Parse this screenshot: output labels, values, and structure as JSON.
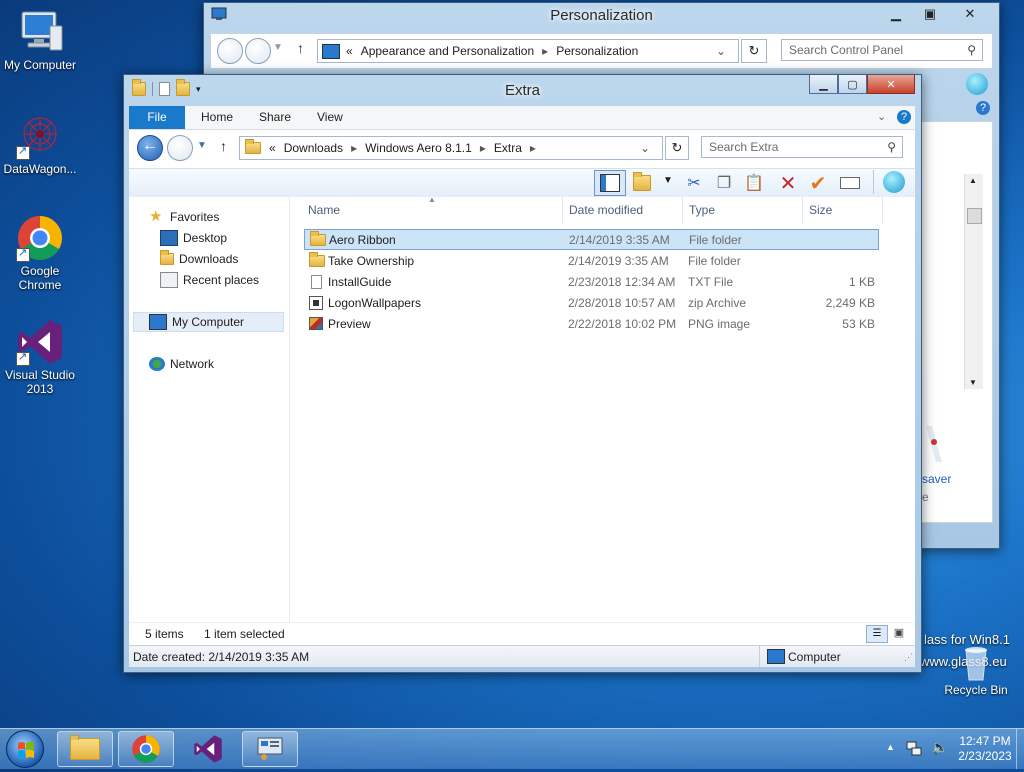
{
  "desktop": {
    "icons": [
      {
        "label": "My Computer"
      },
      {
        "label": "DataWagon..."
      },
      {
        "label": "Google\nChrome"
      },
      {
        "label": "Visual Studio\n2013"
      }
    ],
    "watermark_line1": "lass for Win8.1",
    "watermark_line2": "www.glass8.eu",
    "recycle_bin": "Recycle Bin"
  },
  "personalization": {
    "title": "Personalization",
    "breadcrumb_prefix": "«",
    "breadcrumb": [
      "Appearance and Personalization",
      "Personalization"
    ],
    "search_placeholder": "Search Control Panel",
    "partial_text1": "saver",
    "partial_text2": "e"
  },
  "explorer": {
    "title": "Extra",
    "ribbon_tabs": [
      "File",
      "Home",
      "Share",
      "View"
    ],
    "breadcrumb_prefix": "«",
    "breadcrumb": [
      "Downloads",
      "Windows Aero 8.1.1",
      "Extra"
    ],
    "search_placeholder": "Search Extra",
    "nav": {
      "favorites": "Favorites",
      "desktop": "Desktop",
      "downloads": "Downloads",
      "recent": "Recent places",
      "computer": "My Computer",
      "network": "Network"
    },
    "columns": [
      "Name",
      "Date modified",
      "Type",
      "Size"
    ],
    "files": [
      {
        "name": "Aero Ribbon",
        "date": "2/14/2019 3:35 AM",
        "type": "File folder",
        "size": "",
        "icon": "folder-icon"
      },
      {
        "name": "Take Ownership",
        "date": "2/14/2019 3:35 AM",
        "type": "File folder",
        "size": "",
        "icon": "folder-icon"
      },
      {
        "name": "InstallGuide",
        "date": "2/23/2018 12:34 AM",
        "type": "TXT File",
        "size": "1 KB",
        "icon": "text-file-icon"
      },
      {
        "name": "LogonWallpapers",
        "date": "2/28/2018 10:57 AM",
        "type": "zip Archive",
        "size": "2,249 KB",
        "icon": "zip-icon"
      },
      {
        "name": "Preview",
        "date": "2/22/2018 10:02 PM",
        "type": "PNG image",
        "size": "53 KB",
        "icon": "image-icon"
      }
    ],
    "selected_index": 0,
    "status_items": "5 items",
    "status_selected": "1 item selected",
    "details_text": "Date created: 2/14/2019 3:35 AM",
    "details_location": "Computer"
  },
  "taskbar": {
    "time": "12:47 PM",
    "date": "2/23/2023",
    "tray_arrow": "▲"
  },
  "colors": {
    "accent": "#1979ca",
    "selection": "#cce4f7",
    "selection_border": "#7da2ce"
  }
}
